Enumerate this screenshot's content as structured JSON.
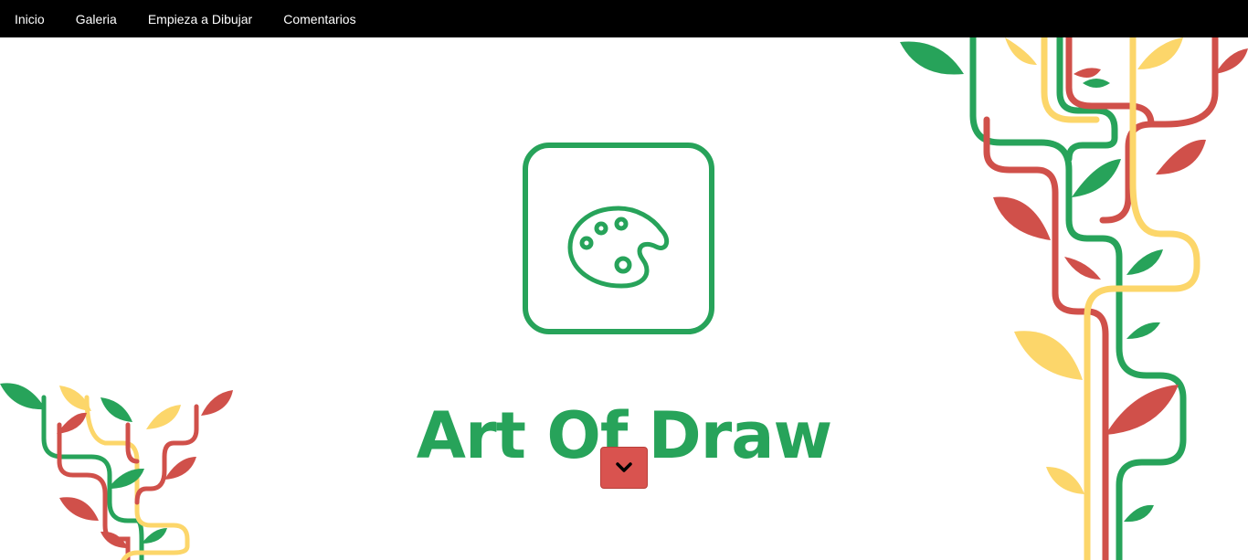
{
  "nav": {
    "items": [
      {
        "label": "Inicio"
      },
      {
        "label": "Galeria"
      },
      {
        "label": "Empieza a Dibujar"
      },
      {
        "label": "Comentarios"
      }
    ]
  },
  "hero": {
    "title": "Art Of Draw",
    "logo_icon": "palette-icon",
    "scroll_icon": "chevron-down-icon"
  },
  "colors": {
    "green": "#27a35a",
    "red": "#d0504a",
    "yellow": "#fcd66a",
    "nav_bg": "#000000",
    "button_bg": "#d9534f"
  }
}
